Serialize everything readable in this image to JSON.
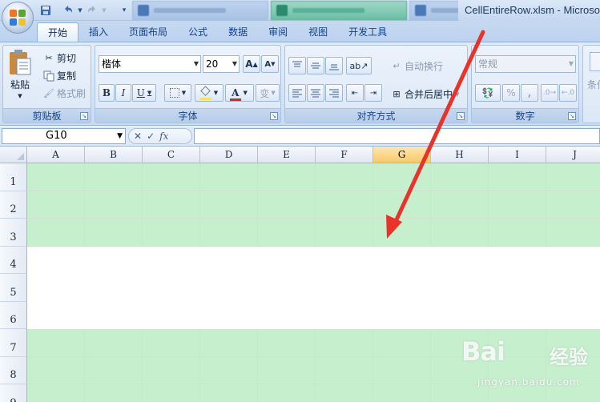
{
  "window": {
    "title": "CellEntireRow.xlsm - Microso"
  },
  "quick_access": {
    "save_icon": "save-icon",
    "undo_icon": "undo-icon",
    "redo_icon": "redo-icon",
    "customize_icon": "chevron-down-icon"
  },
  "ribbon_tabs": [
    {
      "label": "开始",
      "active": true
    },
    {
      "label": "插入",
      "active": false
    },
    {
      "label": "页面布局",
      "active": false
    },
    {
      "label": "公式",
      "active": false
    },
    {
      "label": "数据",
      "active": false
    },
    {
      "label": "审阅",
      "active": false
    },
    {
      "label": "视图",
      "active": false
    },
    {
      "label": "开发工具",
      "active": false
    }
  ],
  "clipboard": {
    "group_label": "剪贴板",
    "paste_label": "粘贴",
    "cut_label": "剪切",
    "copy_label": "复制",
    "format_painter_label": "格式刷"
  },
  "font": {
    "group_label": "字体",
    "font_name": "楷体",
    "font_size": "20",
    "grow_label": "A",
    "shrink_label": "A",
    "bold_label": "B",
    "italic_label": "I",
    "underline_label": "U",
    "font_color_label": "A",
    "phonetic_label": "变",
    "font_color": "#e0231c",
    "fill_color": "#f5e55a"
  },
  "alignment": {
    "group_label": "对齐方式",
    "wrap_text_label": "自动换行",
    "merge_center_label": "合并后居中"
  },
  "number": {
    "group_label": "数字",
    "format_value": "常规",
    "percent_label": "%",
    "comma_label": ","
  },
  "partial_group": {
    "label": "条件"
  },
  "formula_bar": {
    "name_box": "G10",
    "cancel_label": "✕",
    "enter_label": "✓",
    "fx_label": "fx",
    "formula": ""
  },
  "sheet": {
    "columns": [
      "A",
      "B",
      "C",
      "D",
      "E",
      "F",
      "G",
      "H",
      "I",
      "J"
    ],
    "selected_column": "G",
    "rows": [
      {
        "label": "1",
        "fill": "green"
      },
      {
        "label": "2",
        "fill": "green"
      },
      {
        "label": "3",
        "fill": "green"
      },
      {
        "label": "4",
        "fill": "white"
      },
      {
        "label": "5",
        "fill": "white"
      },
      {
        "label": "6",
        "fill": "white"
      },
      {
        "label": "7",
        "fill": "green"
      },
      {
        "label": "8",
        "fill": "green"
      },
      {
        "label": "9",
        "fill": "green"
      }
    ],
    "green_fill": "#c6efce",
    "white_fill": "#ffffff"
  },
  "annotation": {
    "arrow_color": "#e8332a"
  },
  "watermark": {
    "logo_text": "Bai",
    "logo_suffix": "经验",
    "url": "jingyan.baidu.com"
  }
}
